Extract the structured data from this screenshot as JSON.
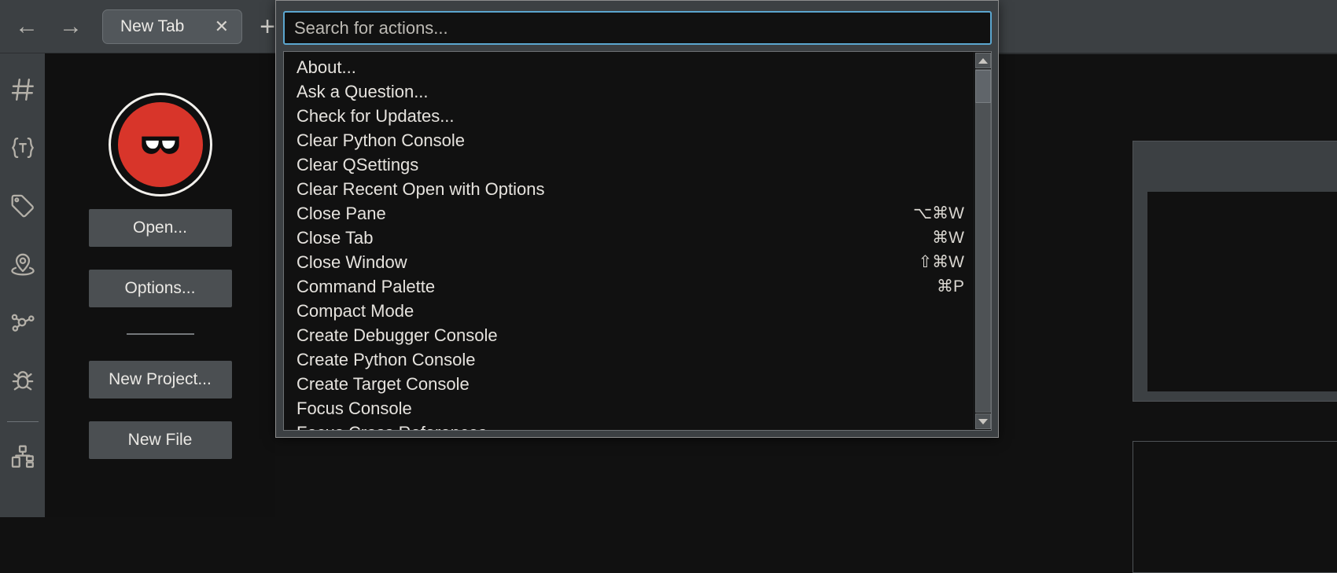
{
  "window": {
    "nav": {
      "back_icon": "arrow-left-icon",
      "forward_icon": "arrow-right-icon",
      "back_glyph": "←",
      "forward_glyph": "→"
    },
    "tabs": [
      {
        "label": "New Tab",
        "close_glyph": "✕"
      }
    ],
    "new_tab_glyph": "+"
  },
  "sidebar": {
    "items": [
      {
        "name": "symbols-icon",
        "title": "Symbols"
      },
      {
        "name": "types-icon",
        "title": "Types"
      },
      {
        "name": "tags-icon",
        "title": "Tags"
      },
      {
        "name": "memory-map-icon",
        "title": "Memory Map"
      },
      {
        "name": "cross-references-icon",
        "title": "Cross References"
      },
      {
        "name": "debugger-icon",
        "title": "Debugger"
      },
      {
        "name": "components-icon",
        "title": "Components"
      }
    ]
  },
  "welcome": {
    "logo_name": "app-logo-goggles",
    "logo_color": "#d8352a",
    "buttons": [
      {
        "label": "Open..."
      },
      {
        "label": "Options..."
      },
      {
        "label": "New Project..."
      },
      {
        "label": "New File"
      }
    ]
  },
  "command_palette": {
    "search": {
      "placeholder": "Search for actions...",
      "value": "",
      "focus_color": "#5ba6cf"
    },
    "actions": [
      {
        "label": "About...",
        "shortcut": ""
      },
      {
        "label": "Ask a Question...",
        "shortcut": ""
      },
      {
        "label": "Check for Updates...",
        "shortcut": ""
      },
      {
        "label": "Clear Python Console",
        "shortcut": ""
      },
      {
        "label": "Clear QSettings",
        "shortcut": ""
      },
      {
        "label": "Clear Recent Open with Options",
        "shortcut": ""
      },
      {
        "label": "Close Pane",
        "shortcut": "⌥⌘W"
      },
      {
        "label": "Close Tab",
        "shortcut": "⌘W"
      },
      {
        "label": "Close Window",
        "shortcut": "⇧⌘W"
      },
      {
        "label": "Command Palette",
        "shortcut": "⌘P"
      },
      {
        "label": "Compact Mode",
        "shortcut": ""
      },
      {
        "label": "Create Debugger Console",
        "shortcut": ""
      },
      {
        "label": "Create Python Console",
        "shortcut": ""
      },
      {
        "label": "Create Target Console",
        "shortcut": ""
      },
      {
        "label": "Focus Console",
        "shortcut": ""
      },
      {
        "label": "Focus Cross References",
        "shortcut": ""
      }
    ],
    "scrollbar": {
      "up_arrow": "scroll-up-icon",
      "down_arrow": "scroll-down-icon"
    }
  }
}
